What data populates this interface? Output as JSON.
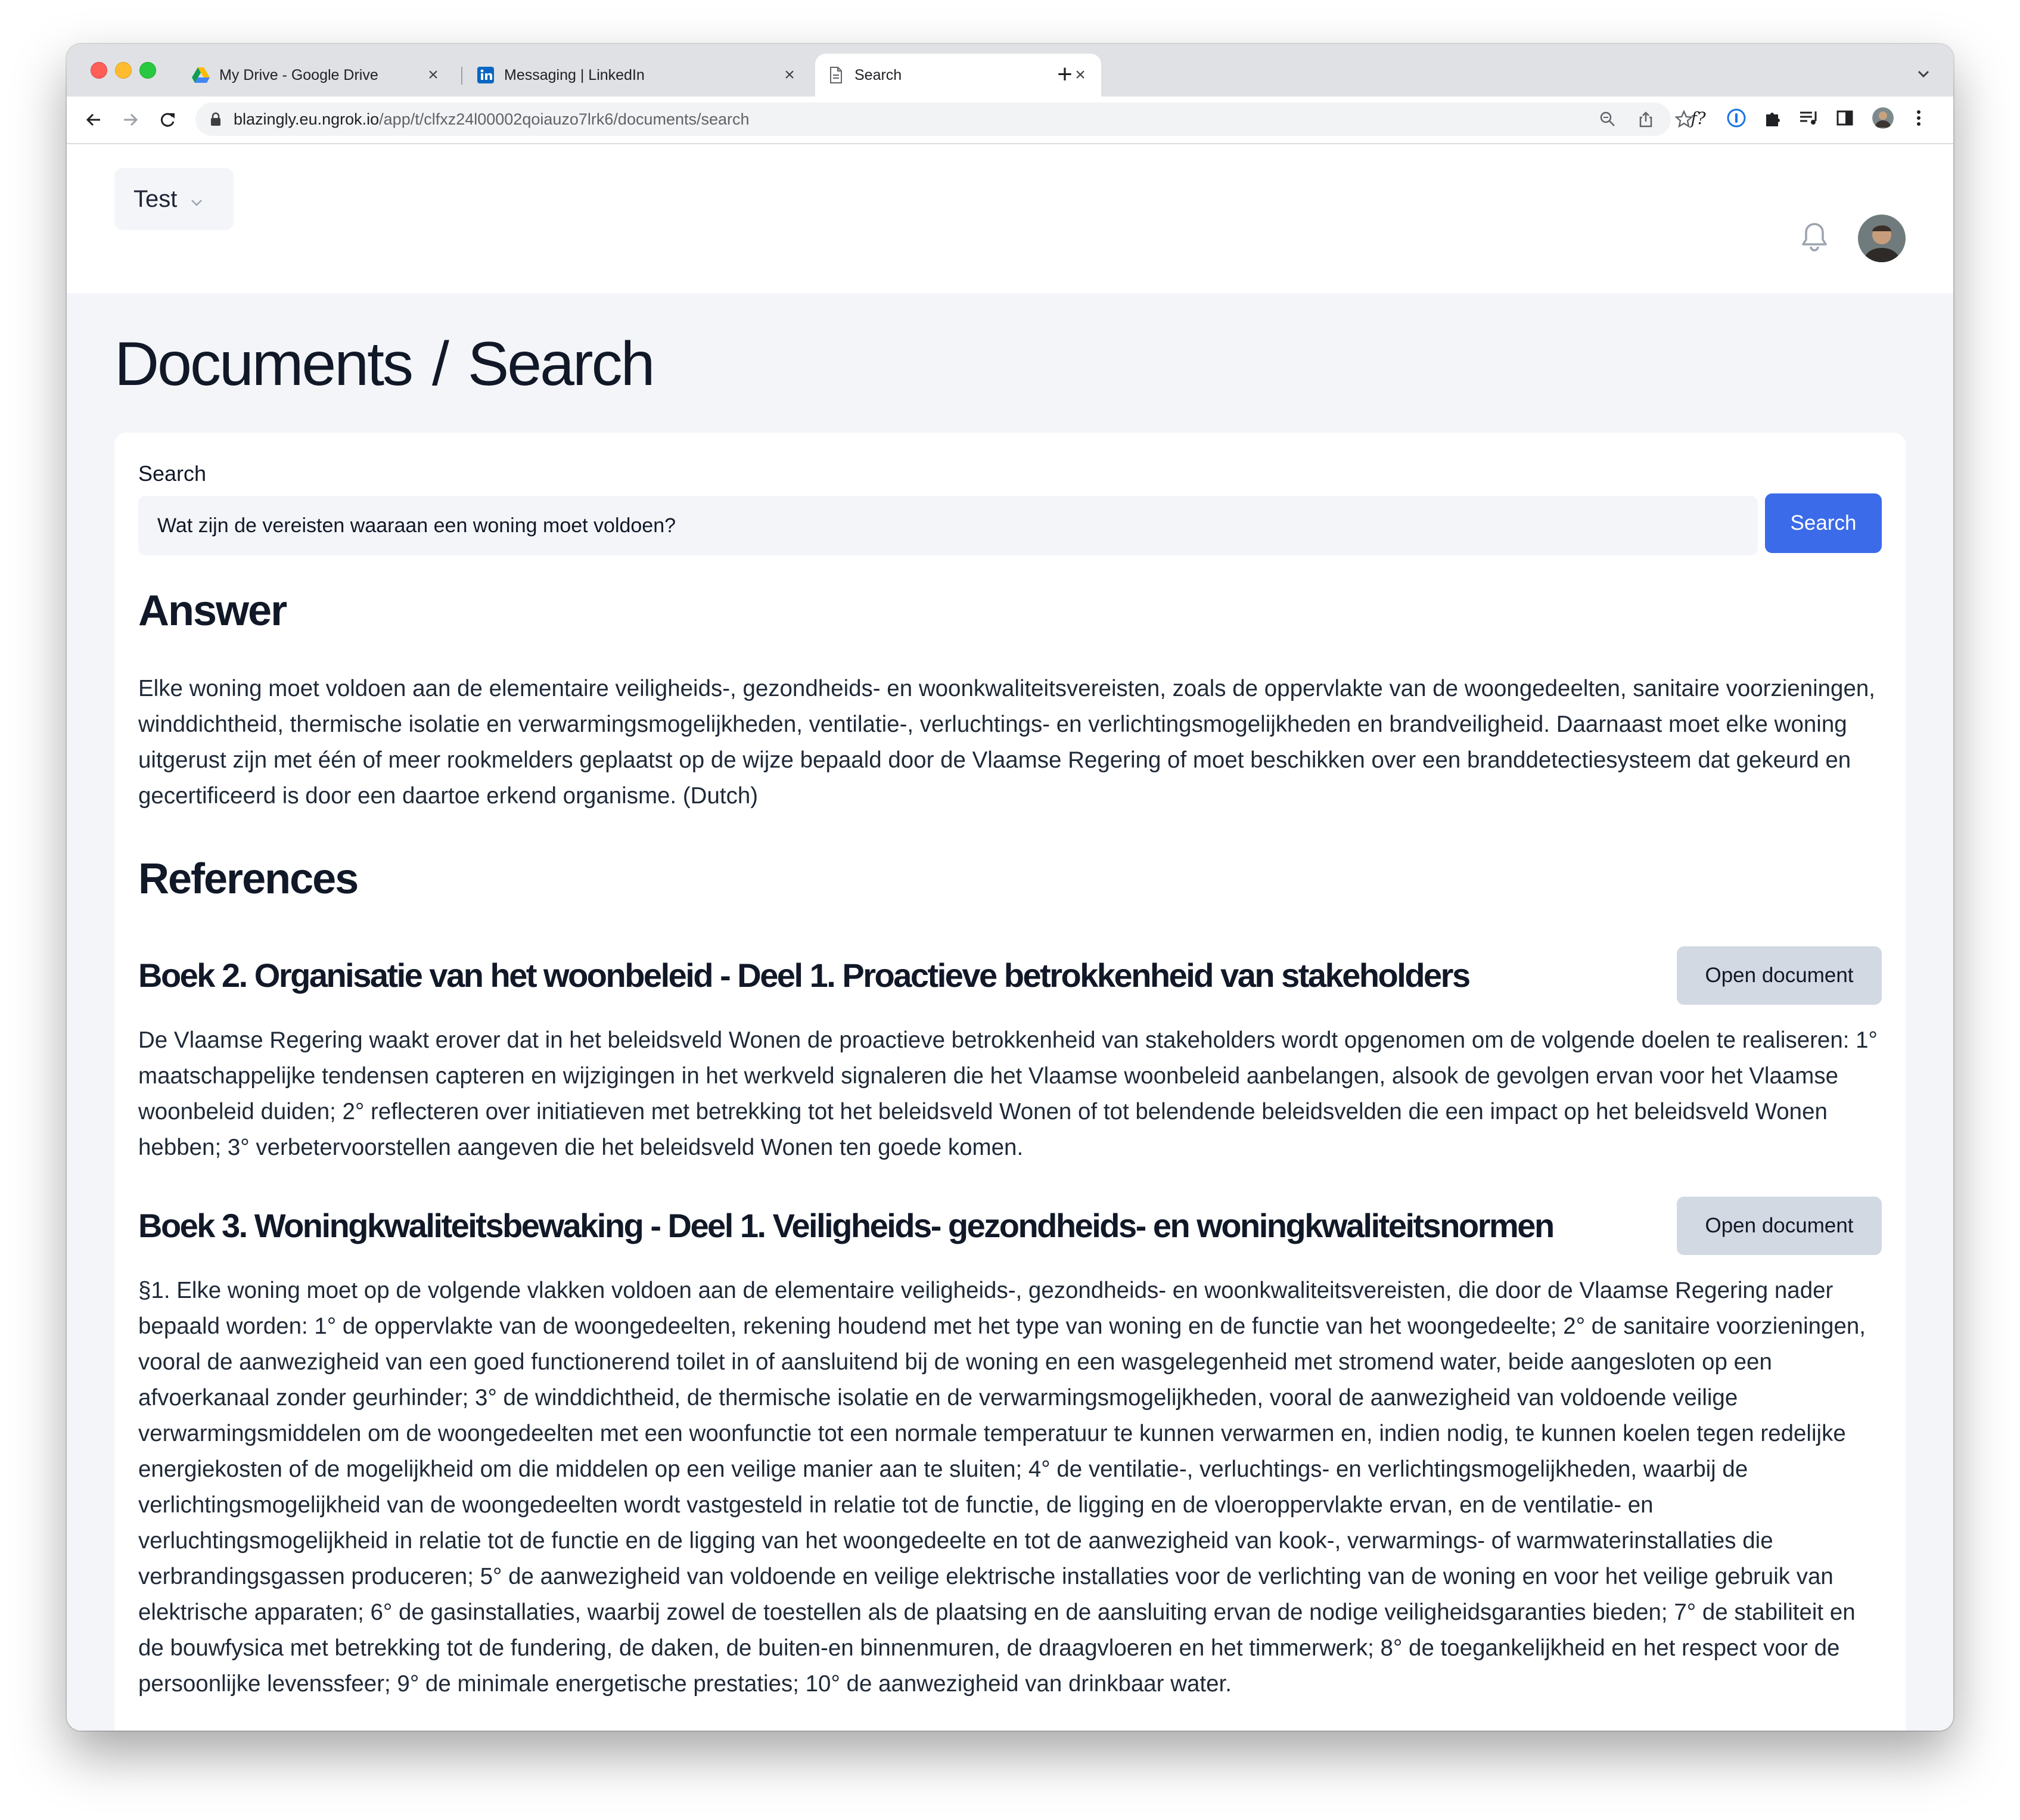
{
  "browser": {
    "tabs": [
      {
        "title": "My Drive - Google Drive",
        "icon": "google-drive-icon"
      },
      {
        "title": "Messaging | LinkedIn",
        "icon": "linkedin-icon"
      },
      {
        "title": "Search",
        "icon": "document-icon",
        "active": true
      }
    ],
    "new_tab": "+",
    "url_host": "blazingly.eu.ngrok.io",
    "url_path": "/app/t/clfxz24l00002qoiauzo7lrk6/documents/search"
  },
  "header": {
    "workspace": "Test"
  },
  "page": {
    "breadcrumb": [
      "Documents",
      "Search"
    ],
    "breadcrumb_separator": "/"
  },
  "search": {
    "label": "Search",
    "value": "Wat zijn de vereisten waaraan een woning moet voldoen?",
    "button": "Search"
  },
  "answer": {
    "heading": "Answer",
    "text": "Elke woning moet voldoen aan de elementaire veiligheids-, gezondheids- en woonkwaliteitsvereisten, zoals de oppervlakte van de woongedeelten, sanitaire voorzieningen, winddichtheid, thermische isolatie en verwarmingsmogelijkheden, ventilatie-, verluchtings- en verlichtingsmogelijkheden en brandveiligheid. Daarnaast moet elke woning uitgerust zijn met één of meer rookmelders geplaatst op de wijze bepaald door de Vlaamse Regering of moet beschikken over een branddetectiesysteem dat gekeurd en gecertificeerd is door een daartoe erkend organisme. (Dutch)"
  },
  "references": {
    "heading": "References",
    "items": [
      {
        "title": "Boek 2. Organisatie van het woonbeleid - Deel 1. Proactieve betrokkenheid van stakeholders",
        "button": "Open document",
        "text": "De Vlaamse Regering waakt erover dat in het beleidsveld Wonen de proactieve betrokkenheid van stakeholders wordt opgenomen om de volgende doelen te realiseren: 1° maatschappelijke tendensen capteren en wijzigingen in het werkveld signaleren die het Vlaamse woonbeleid aanbelangen, alsook de gevolgen ervan voor het Vlaamse woonbeleid duiden; 2° reflecteren over initiatieven met betrekking tot het beleidsveld Wonen of tot belendende beleidsvelden die een impact op het beleidsveld Wonen hebben; 3° verbetervoorstellen aangeven die het beleidsveld Wonen ten goede komen."
      },
      {
        "title": "Boek 3. Woningkwaliteitsbewaking - Deel 1. Veiligheids- gezondheids- en woningkwaliteitsnormen",
        "button": "Open document",
        "text": "§1. Elke woning moet op de volgende vlakken voldoen aan de elementaire veiligheids-, gezondheids- en woonkwaliteitsvereisten, die door de Vlaamse Regering nader bepaald worden: 1° de oppervlakte van de woongedeelten, rekening houdend met het type van woning en de functie van het woongedeelte; 2° de sanitaire voorzieningen, vooral de aanwezigheid van een goed functionerend toilet in of aansluitend bij de woning en een wasgelegenheid met stromend water, beide aangesloten op een afvoerkanaal zonder geurhinder; 3° de winddichtheid, de thermische isolatie en de verwarmingsmogelijkheden, vooral de aanwezigheid van voldoende veilige verwarmingsmiddelen om de woongedeelten met een woonfunctie tot een normale temperatuur te kunnen verwarmen en, indien nodig, te kunnen koelen tegen redelijke energiekosten of de mogelijkheid om die middelen op een veilige manier aan te sluiten; 4° de ventilatie-, verluchtings- en verlichtingsmogelijkheden, waarbij de verlichtingsmogelijkheid van de woongedeelten wordt vastgesteld in relatie tot de functie, de ligging en de vloeroppervlakte ervan, en de ventilatie- en verluchtingsmogelijkheid in relatie tot de functie en de ligging van het woongedeelte en tot de aanwezigheid van kook-, verwarmings- of warmwaterinstallaties die verbrandingsgassen produceren; 5° de aanwezigheid van voldoende en veilige elektrische installaties voor de verlichting van de woning en voor het veilige gebruik van elektrische apparaten; 6° de gasinstallaties, waarbij zowel de toestellen als de plaatsing en de aansluiting ervan de nodige veiligheidsgaranties bieden; 7° de stabiliteit en de bouwfysica met betrekking tot de fundering, de daken, de buiten-en binnenmuren, de draagvloeren en het timmerwerk; 8° de toegankelijkheid en het respect voor de persoonlijke levenssfeer; 9° de minimale energetische prestaties; 10° de aanwezigheid van drinkbaar water."
      }
    ]
  },
  "colors": {
    "primary": "#3b6be8",
    "page_bg": "#f3f5f9",
    "secondary_button": "#d2d9e3"
  }
}
